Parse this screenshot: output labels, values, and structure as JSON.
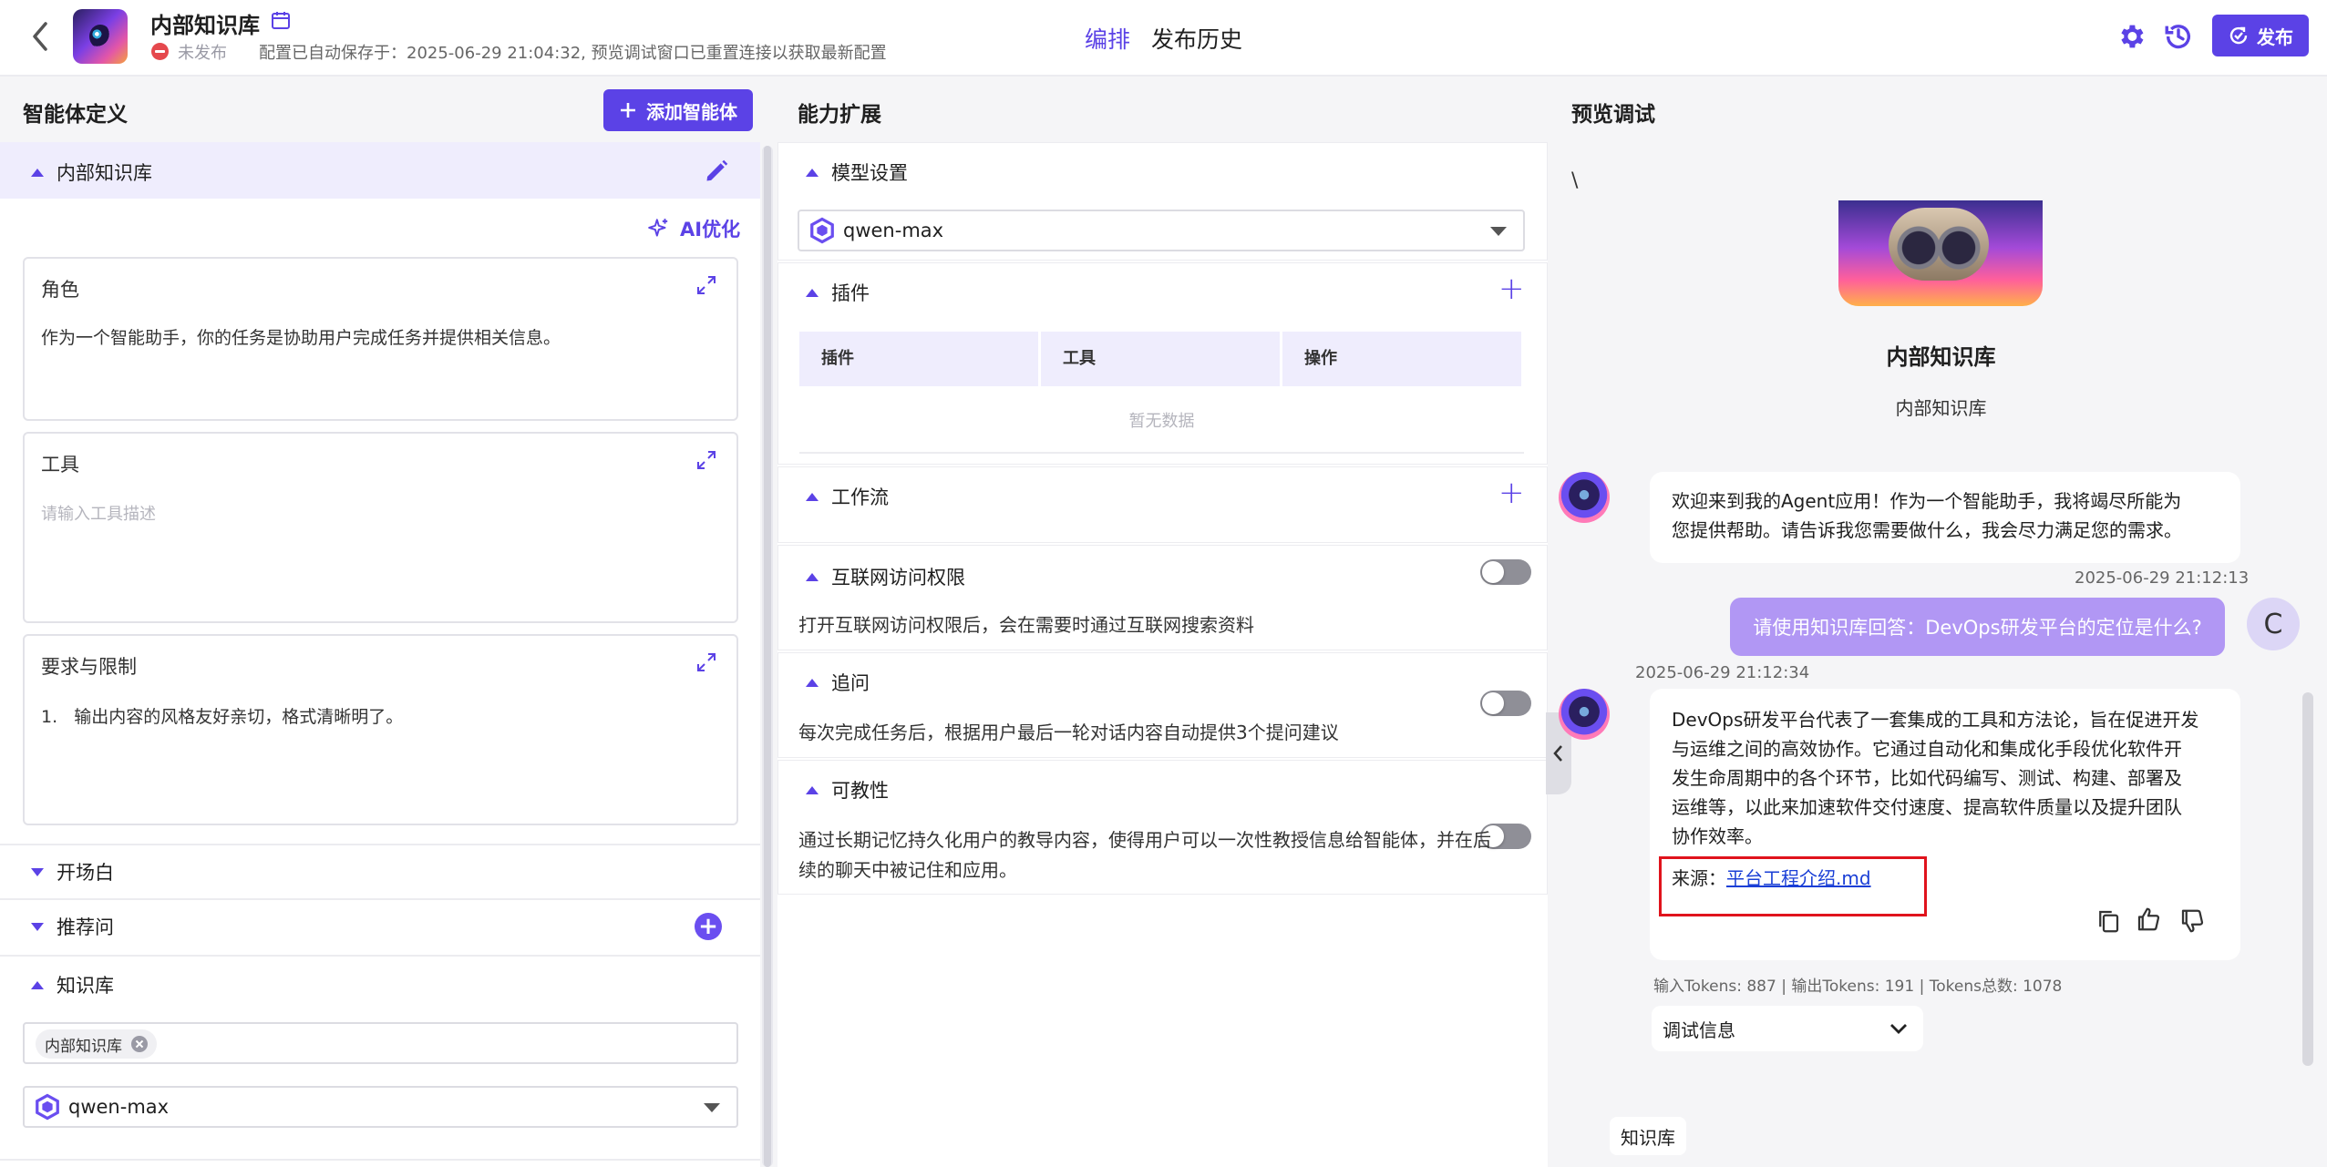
{
  "header": {
    "app_title": "内部知识库",
    "status": "未发布",
    "autosave": "配置已自动保存于：2025-06-29 21:04:32, 预览调试窗口已重置连接以获取最新配置",
    "tabs": [
      "编排",
      "发布历史"
    ],
    "active_tab": "编排",
    "publish_label": "发布"
  },
  "left": {
    "section_title": "智能体定义",
    "add_agent_label": "添加智能体",
    "agent_name": "内部知识库",
    "ai_optimize": "AI优化",
    "role": {
      "title": "角色",
      "content": "作为一个智能助手，你的任务是协助用户完成任务并提供相关信息。"
    },
    "tools": {
      "title": "工具",
      "placeholder": "请输入工具描述"
    },
    "requirements": {
      "title": "要求与限制",
      "item_number": "1.",
      "item_text": "输出内容的风格友好亲切，格式清晰明了。"
    },
    "opening": "开场白",
    "suggested": "推荐问",
    "knowledge": "知识库",
    "kb_chip": "内部知识库",
    "model": "qwen-max"
  },
  "middle": {
    "section_title": "能力扩展",
    "model_settings": "模型设置",
    "model": "qwen-max",
    "plugins": "插件",
    "table_headers": [
      "插件",
      "工具",
      "操作"
    ],
    "empty": "暂无数据",
    "workflow": "工作流",
    "internet": {
      "title": "互联网访问权限",
      "desc": "打开互联网访问权限后，会在需要时通过互联网搜索资料",
      "enabled": false
    },
    "followup": {
      "title": "追问",
      "desc": "每次完成任务后，根据用户最后一轮对话内容自动提供3个提问建议",
      "enabled": false
    },
    "teachable": {
      "title": "可教性",
      "desc_line1": "通过长期记忆持久化用户的教导内容，使得用户可以一次性教授信息给智能体，并在后",
      "desc_line2": "续的聊天中被记住和应用。",
      "enabled": false
    }
  },
  "right": {
    "section_title": "预览调试",
    "stray_char": "\\",
    "agent_name": "内部知识库",
    "agent_desc": "内部知识库",
    "welcome_line1": "欢迎来到我的Agent应用！作为一个智能助手，我将竭尽所能为",
    "welcome_line2": "您提供帮助。请告诉我您需要做什么，我会尽力满足您的需求。",
    "user_time": "2025-06-29 21:12:13",
    "user_message": "请使用知识库回答：DevOps研发平台的定位是什么?",
    "user_initial": "C",
    "bot_time": "2025-06-29 21:12:34",
    "answer_lines": [
      "DevOps研发平台代表了一套集成的工具和方法论，旨在促进开发",
      "与运维之间的高效协作。它通过自动化和集成化手段优化软件开",
      "发生命周期中的各个环节，比如代码编写、测试、构建、部署及",
      "运维等，以此来加速软件交付速度、提高软件质量以及提升团队",
      "协作效率。"
    ],
    "source_label": "来源：",
    "source_link": "平台工程介绍.md",
    "tokens_in": "输入Tokens: 887",
    "tokens_out": "输出Tokens: 191",
    "tokens_total": "Tokens总数: 1078",
    "debug_info": "调试信息",
    "kb_tag": "知识库"
  },
  "colors": {
    "accent": "#5b42e6",
    "accent_light": "#efedfd",
    "user_bubble": "#b197f4",
    "error": "#e5484d",
    "highlight_border": "#e0131c"
  },
  "icons": [
    "back-icon",
    "calendar-icon",
    "settings-icon",
    "history-icon",
    "publish-icon",
    "plus-icon",
    "edit-icon",
    "sparkle-icon",
    "expand-icon",
    "model-logo-icon",
    "chevron-down-icon",
    "copy-icon",
    "thumb-up-icon",
    "thumb-down-icon",
    "chevron-left-icon"
  ]
}
